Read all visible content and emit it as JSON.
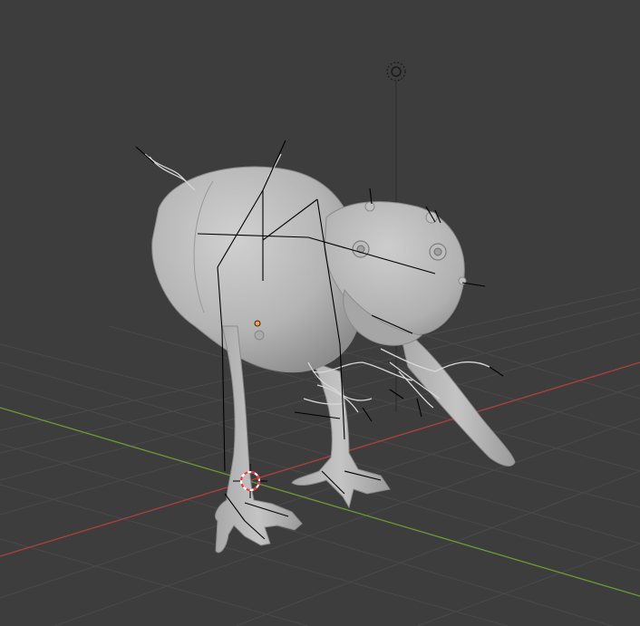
{
  "viewport": {
    "view": "3D Viewport",
    "shading": "solid",
    "background_color": "#3d3d3d",
    "grid_line_color": "#4a4a4a",
    "x_axis_color": "#b0403f",
    "y_axis_color": "#6f9a35",
    "mesh_color": "#b9b9b9",
    "armature_color": "#000000",
    "origin_color": "#ffa033",
    "cursor_colors": [
      "#ff3030",
      "#ffffff"
    ]
  },
  "scene": {
    "objects": [
      {
        "name": "creature-mesh",
        "type": "mesh",
        "icon": "mesh-icon"
      },
      {
        "name": "creature-armature",
        "type": "armature",
        "icon": "bone-icon"
      },
      {
        "name": "light",
        "type": "light",
        "icon": "light-icon"
      },
      {
        "name": "3d-cursor",
        "type": "cursor",
        "icon": "crosshair-icon"
      }
    ]
  }
}
